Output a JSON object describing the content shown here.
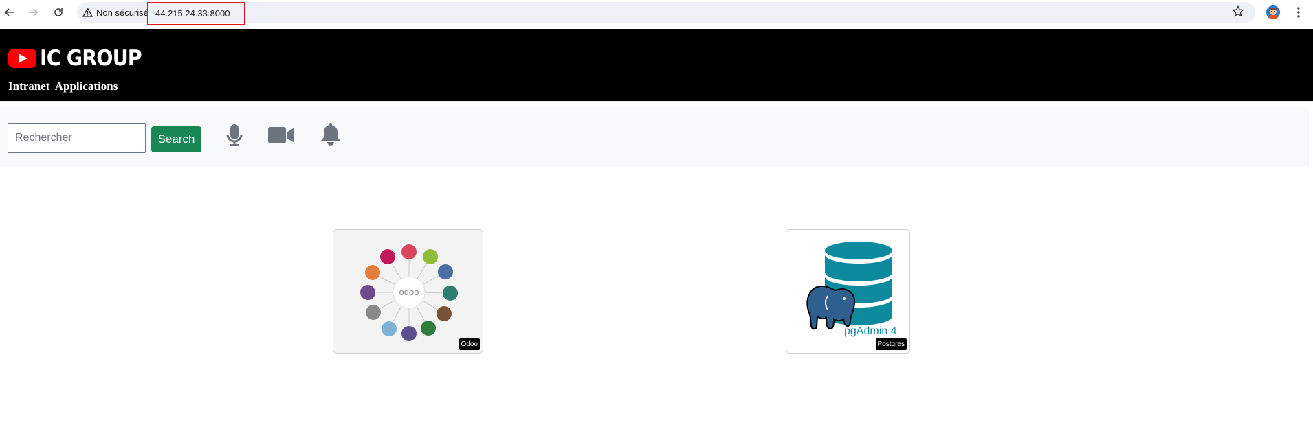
{
  "browser": {
    "security_label": "Non sécurisé",
    "url": "44.215.24.33:8000",
    "icons": [
      "back-arrow-icon",
      "forward-arrow-icon",
      "reload-icon",
      "warning-icon",
      "star-icon",
      "profile-avatar",
      "more-vert-icon"
    ]
  },
  "header": {
    "brand": "IC GROUP",
    "subtitle": "Intranet Applications",
    "background": "#000000"
  },
  "toolbar": {
    "search_placeholder": "Rechercher",
    "search_label": "Search",
    "search_color": "#198754",
    "icons": [
      "microphone-icon",
      "video-camera-icon",
      "bell-icon"
    ]
  },
  "apps": [
    {
      "badge": "Odoo",
      "image_icon": "odoo-modules-diagram",
      "center_text": "odoo"
    },
    {
      "badge": "Postgres",
      "image_icon": "pgadmin-logo",
      "logo_text": "pgAdmin 4"
    }
  ]
}
